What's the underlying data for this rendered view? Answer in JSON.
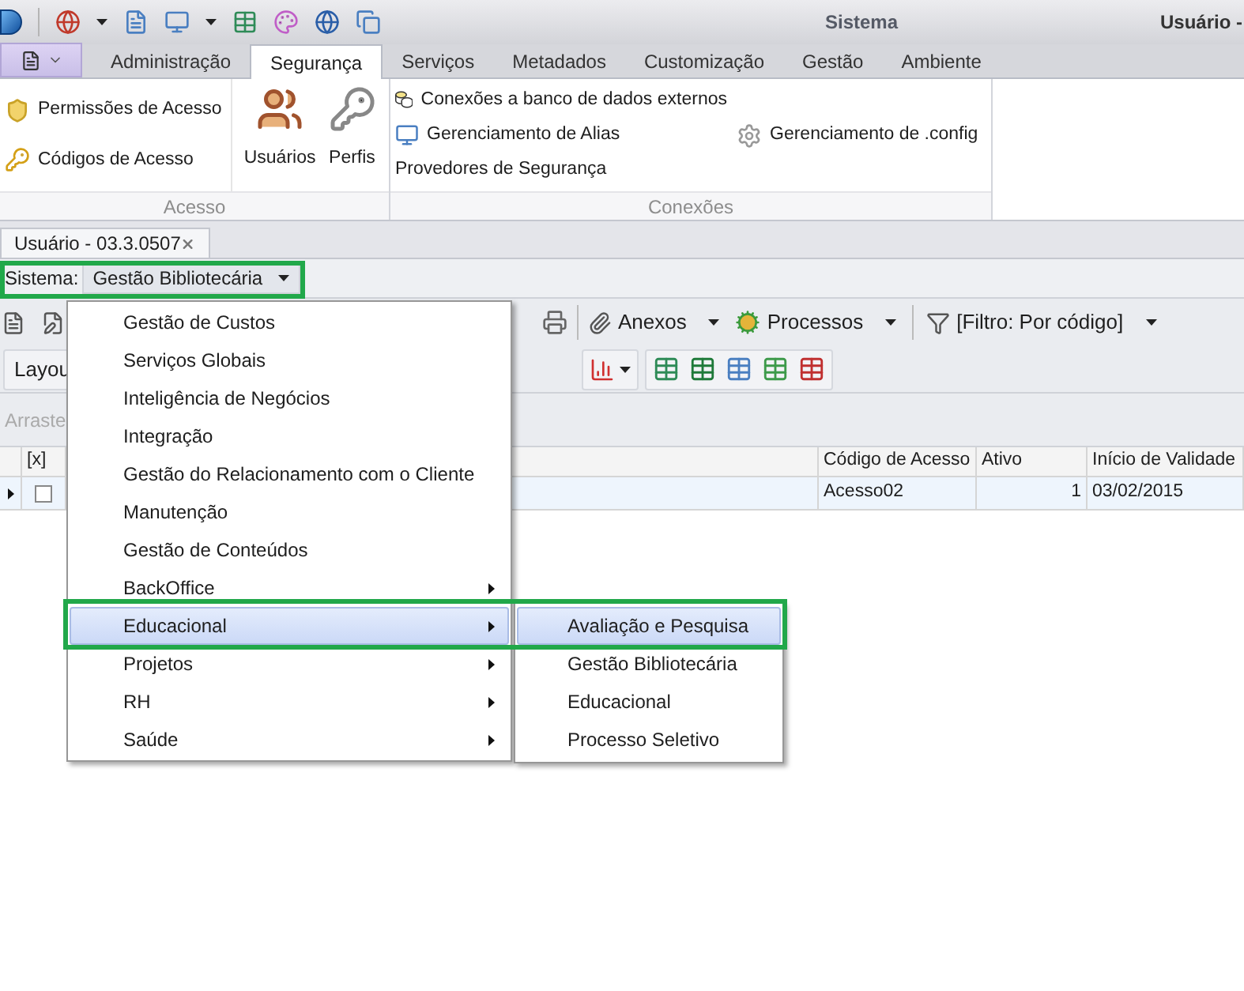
{
  "title_bar": {
    "title": "Sistema",
    "user": "Usuário -"
  },
  "ribbon_tabs": [
    {
      "label": "Administração",
      "selected": false
    },
    {
      "label": "Segurança",
      "selected": true
    },
    {
      "label": "Serviços",
      "selected": false
    },
    {
      "label": "Metadados",
      "selected": false
    },
    {
      "label": "Customização",
      "selected": false
    },
    {
      "label": "Gestão",
      "selected": false
    },
    {
      "label": "Ambiente",
      "selected": false
    }
  ],
  "ribbon_groups": [
    {
      "label": "Acesso",
      "columns": [
        {
          "kind": "small",
          "items": [
            "Permissões de Acesso",
            "Códigos de Acesso"
          ]
        },
        {
          "kind": "large",
          "items": [
            "Usuários",
            "Perfis"
          ]
        }
      ]
    },
    {
      "label": "Conexões",
      "columns": [
        {
          "kind": "small",
          "items": [
            "Conexões a banco de dados externos",
            "Gerenciamento de Alias",
            "Provedores de Segurança"
          ]
        },
        {
          "kind": "small",
          "items": [
            "Gerenciamento de .config"
          ]
        }
      ]
    }
  ],
  "document_tab": {
    "title": "Usuário - 03.3.0507"
  },
  "system_selector": {
    "label": "Sistema:",
    "value": "Gestão Bibliotecária",
    "highlighted": true
  },
  "toolbar": {
    "buttons": [
      "Anexos",
      "Processos",
      "[Filtro: Por código]"
    ]
  },
  "toolbar_2": {
    "label": "Layou"
  },
  "group_panel": {
    "hint": "Arraste"
  },
  "grid": {
    "columns": [
      "",
      "[x]",
      "",
      "Código de Acesso",
      "Ativo",
      "Início de Validade"
    ],
    "rows": [
      {
        "checked": false,
        "cells": [
          "",
          "",
          "",
          "Acesso02",
          "1",
          "03/02/2015"
        ]
      }
    ]
  },
  "menu": {
    "highlighted": true,
    "items": [
      {
        "label": "Gestão de Custos",
        "submenu": false,
        "selected": false
      },
      {
        "label": "Serviços Globais",
        "submenu": false,
        "selected": false
      },
      {
        "label": "Inteligência de Negócios",
        "submenu": false,
        "selected": false
      },
      {
        "label": "Integração",
        "submenu": false,
        "selected": false
      },
      {
        "label": "Gestão do Relacionamento com o Cliente",
        "submenu": false,
        "selected": false
      },
      {
        "label": "Manutenção",
        "submenu": false,
        "selected": false
      },
      {
        "label": "Gestão de Conteúdos",
        "submenu": false,
        "selected": false
      },
      {
        "label": "BackOffice",
        "submenu": true,
        "selected": false
      },
      {
        "label": "Educacional",
        "submenu": true,
        "selected": true
      },
      {
        "label": "Projetos",
        "submenu": true,
        "selected": false
      },
      {
        "label": "RH",
        "submenu": true,
        "selected": false
      },
      {
        "label": "Saúde",
        "submenu": true,
        "selected": false
      }
    ],
    "submenu": [
      {
        "label": "Avaliação e Pesquisa",
        "selected": true
      },
      {
        "label": "Gestão Bibliotecária",
        "selected": false
      },
      {
        "label": "Educacional",
        "selected": false
      },
      {
        "label": "Processo Seletivo",
        "selected": false
      }
    ]
  }
}
